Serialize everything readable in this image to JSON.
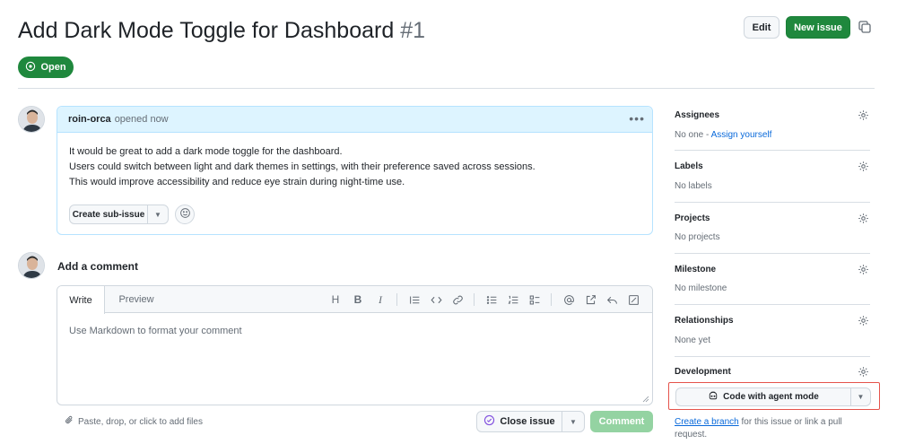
{
  "issue": {
    "title": "Add Dark Mode Toggle for Dashboard",
    "number": "#1",
    "status": "Open"
  },
  "header": {
    "edit_label": "Edit",
    "new_issue_label": "New issue"
  },
  "comment": {
    "author": "roin-orca",
    "meta": "opened now",
    "body": [
      "It would be great to add a dark mode toggle for the dashboard.",
      "Users could switch between light and dark themes in settings, with their preference saved across sessions.",
      "This would improve accessibility and reduce eye strain during night-time use."
    ],
    "create_sub_issue_label": "Create sub-issue"
  },
  "new_comment": {
    "heading": "Add a comment",
    "tabs": [
      "Write",
      "Preview"
    ],
    "toolbar_text_tools": [
      "H",
      "B",
      "I"
    ],
    "placeholder": "Use Markdown to format your comment",
    "paste_hint": "Paste, drop, or click to add files",
    "close_issue_label": "Close issue",
    "comment_label": "Comment"
  },
  "sidebar": {
    "sections": [
      {
        "heading": "Assignees",
        "value_prefix": "No one - ",
        "value_link": "Assign yourself"
      },
      {
        "heading": "Labels",
        "value": "No labels"
      },
      {
        "heading": "Projects",
        "value": "No projects"
      },
      {
        "heading": "Milestone",
        "value": "No milestone"
      },
      {
        "heading": "Relationships",
        "value": "None yet"
      },
      {
        "heading": "Development"
      }
    ],
    "development": {
      "agent_button_label": "Code with agent mode",
      "branch_link": "Create a branch",
      "branch_suffix": " for this issue or link a pull request."
    }
  },
  "colors": {
    "primary_green": "#1f883d",
    "link_blue": "#0969da",
    "highlight_red": "#e5534b"
  }
}
